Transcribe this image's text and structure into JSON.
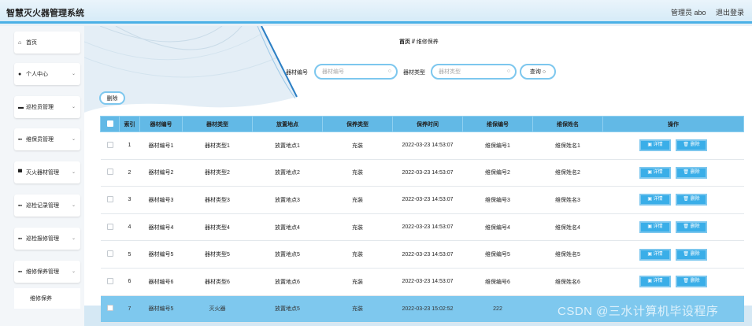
{
  "header": {
    "title": "智慧灭火器管理系统",
    "user": "管理员 abo",
    "logout": "退出登录"
  },
  "sidebar": {
    "items": [
      {
        "label": "首页",
        "icon": "home-icon",
        "glyph": "⌂",
        "chevron": false
      },
      {
        "label": "个人中心",
        "icon": "user-icon",
        "glyph": "●",
        "chevron": true
      },
      {
        "label": "巡检员管理",
        "icon": "briefcase-icon",
        "glyph": "▬",
        "chevron": true
      },
      {
        "label": "维保员管理",
        "icon": "grid-icon",
        "glyph": "▪▪",
        "chevron": true
      },
      {
        "label": "灭火器材管理",
        "icon": "device-icon",
        "glyph": "▀",
        "chevron": true
      },
      {
        "label": "巡检记录管理",
        "icon": "grid-icon",
        "glyph": "▪▪",
        "chevron": true
      },
      {
        "label": "巡检报修管理",
        "icon": "grid-icon",
        "glyph": "▪▪",
        "chevron": true
      },
      {
        "label": "维修保养管理",
        "icon": "grid-icon",
        "glyph": "▪▪",
        "chevron": true
      }
    ],
    "sub_item": "维修保养"
  },
  "breadcrumb": {
    "home": "首页",
    "sep": "//",
    "current": "维修保养"
  },
  "search": {
    "code_label": "器材编号",
    "code_placeholder": "器材编号",
    "type_label": "器材类型",
    "type_placeholder": "器材类型",
    "query_label": "查询"
  },
  "toolbar": {
    "delete_label": "删除"
  },
  "table": {
    "headers": [
      "索引",
      "器材编号",
      "器材类型",
      "放置地点",
      "保养类型",
      "保养时间",
      "维保编号",
      "维保姓名",
      "操作"
    ],
    "detail_label": "详情",
    "delete_label": "删除",
    "rows": [
      [
        "1",
        "器材编号1",
        "器材类型1",
        "放置地点1",
        "充装",
        "2022-03-23 14:53:07",
        "维保编号1",
        "维保姓名1"
      ],
      [
        "2",
        "器材编号2",
        "器材类型2",
        "放置地点2",
        "充装",
        "2022-03-23 14:53:07",
        "维保编号2",
        "维保姓名2"
      ],
      [
        "3",
        "器材编号3",
        "器材类型3",
        "放置地点3",
        "充装",
        "2022-03-23 14:53:07",
        "维保编号3",
        "维保姓名3"
      ],
      [
        "4",
        "器材编号4",
        "器材类型4",
        "放置地点4",
        "充装",
        "2022-03-23 14:53:07",
        "维保编号4",
        "维保姓名4"
      ],
      [
        "5",
        "器材编号5",
        "器材类型5",
        "放置地点5",
        "充装",
        "2022-03-23 14:53:07",
        "维保编号5",
        "维保姓名5"
      ],
      [
        "6",
        "器材编号6",
        "器材类型6",
        "放置地点6",
        "充装",
        "2022-03-23 14:53:07",
        "维保编号6",
        "维保姓名6"
      ],
      [
        "7",
        "器材编号5",
        "灭火器",
        "放置地点5",
        "充装",
        "2022-03-23 15:02:52",
        "222",
        ""
      ]
    ]
  },
  "watermark": "CSDN @三水计算机毕设程序",
  "colors": {
    "accent": "#4ab0e6",
    "header_row": "#62b9e6",
    "selected_row": "#7ec8ee",
    "button_fill": "#3aaee8"
  }
}
